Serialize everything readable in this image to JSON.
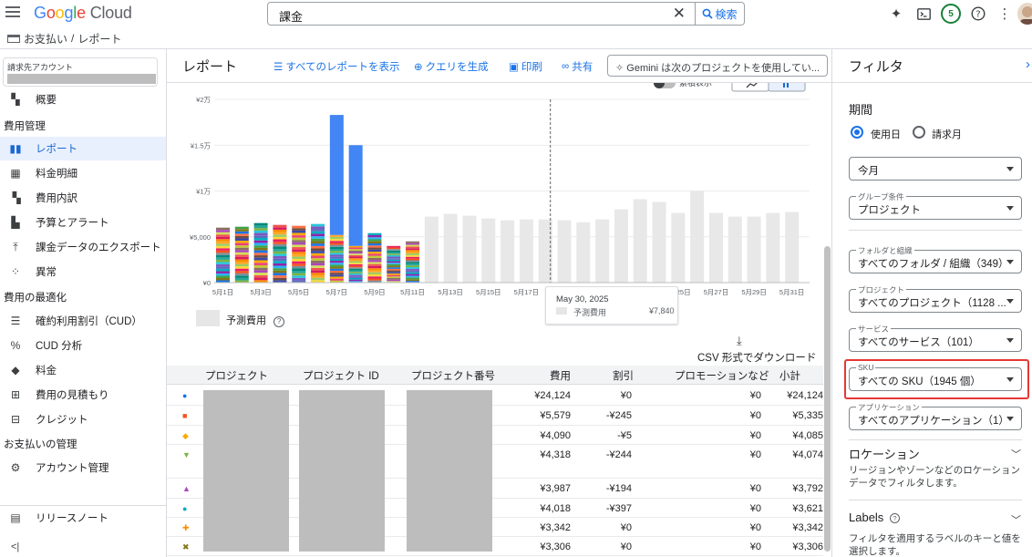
{
  "header": {
    "logo_parts": [
      "G",
      "o",
      "o",
      "g",
      "l",
      "e"
    ],
    "logo_suffix": "Cloud",
    "search_value": "課金",
    "search_button": "検索",
    "notification_count": "5"
  },
  "breadcrumb": {
    "items": [
      "お支払い",
      "/",
      "レポート"
    ]
  },
  "sidebar": {
    "account_label": "請求先アカウント",
    "top_item": {
      "label": "概要",
      "icon": "dashboard-icon"
    },
    "sections": [
      {
        "title": "費用管理"
      },
      {
        "title": "費用の最適化"
      },
      {
        "title": "お支払いの管理"
      }
    ],
    "cost_items": [
      {
        "label": "レポート",
        "icon": "bar-chart-icon",
        "active": true
      },
      {
        "label": "料金明細",
        "icon": "table-icon"
      },
      {
        "label": "費用内訳",
        "icon": "waterfall-icon"
      },
      {
        "label": "予算とアラート",
        "icon": "budget-icon"
      },
      {
        "label": "課金データのエクスポート",
        "icon": "export-icon"
      },
      {
        "label": "異常",
        "icon": "anomaly-icon"
      }
    ],
    "optimize_items": [
      {
        "label": "確約利用割引（CUD）",
        "icon": "list-icon"
      },
      {
        "label": "CUD 分析",
        "icon": "percent-icon"
      },
      {
        "label": "料金",
        "icon": "tag-icon"
      },
      {
        "label": "費用の見積もり",
        "icon": "calculator-icon"
      },
      {
        "label": "クレジット",
        "icon": "gift-icon"
      }
    ],
    "payment_items": [
      {
        "label": "アカウント管理",
        "icon": "gear-icon"
      }
    ],
    "release_notes": "リリースノート",
    "collapse": "<|"
  },
  "main": {
    "title": "レポート",
    "toolbar": {
      "all_reports": "すべてのレポートを表示",
      "generate_query": "クエリを生成",
      "print": "印刷",
      "share": "共有",
      "gemini": "Gemini は次のプロジェクトを使用してい..."
    },
    "cumulative_label": "累積表示",
    "chart_legend": "予測費用",
    "download": "CSV 形式でダウンロード",
    "tooltip": {
      "date": "May 30, 2025",
      "series": "予測費用",
      "value": "¥7,840"
    }
  },
  "chart_data": {
    "type": "bar",
    "stacked": true,
    "ylim": [
      0,
      20000
    ],
    "y_ticks": [
      "¥0",
      "¥5,000",
      "¥1万",
      "¥1.5万",
      "¥2万"
    ],
    "y_tick_values": [
      0,
      5000,
      10000,
      15000,
      20000
    ],
    "x_tick_labels": [
      "5月1日",
      "5月3日",
      "5月5日",
      "5月7日",
      "5月9日",
      "5月11日",
      "5月13日",
      "5月15日",
      "5月17日",
      "5月19日",
      "5月21日",
      "5月23日",
      "5月25日",
      "5月27日",
      "5月29日",
      "5月31日"
    ],
    "days": [
      1,
      2,
      3,
      4,
      5,
      6,
      7,
      8,
      9,
      10,
      11,
      12,
      13,
      14,
      15,
      16,
      17,
      18,
      19,
      20,
      21,
      22,
      23,
      24,
      25,
      26,
      27,
      28,
      29,
      30,
      31
    ],
    "actual_totals": [
      6000,
      6100,
      6500,
      6300,
      6200,
      6400,
      18300,
      15000,
      5400,
      4000,
      4500
    ],
    "forecast_totals": [
      7200,
      7500,
      7300,
      7000,
      6800,
      6900,
      6900,
      6800,
      6600,
      6900,
      8000,
      9100,
      8800,
      7600,
      10000,
      7600,
      7200,
      7200,
      7600,
      7700,
      7600,
      7800
    ],
    "highlight_bar_value": [
      13100,
      11000
    ],
    "forecast_start_day": 12,
    "today_marker_day": 18,
    "grid": true,
    "legend": "bottom-left"
  },
  "table": {
    "columns": [
      "プロジェクト",
      "プロジェクト ID",
      "プロジェクト番号",
      "費用",
      "割引",
      "プロモーションなど",
      "小計"
    ],
    "sort_indicator": "↓",
    "rows": [
      {
        "marker": "●",
        "marker_color": "#1a73e8",
        "cost": "¥24,124",
        "discount": "¥0",
        "promo": "¥0",
        "subtotal": "¥24,124"
      },
      {
        "marker": "■",
        "marker_color": "#f4511e",
        "cost": "¥5,579",
        "discount": "-¥245",
        "promo": "¥0",
        "subtotal": "¥5,335"
      },
      {
        "marker": "◆",
        "marker_color": "#f9ab00",
        "cost": "¥4,090",
        "discount": "-¥5",
        "promo": "¥0",
        "subtotal": "¥4,085"
      },
      {
        "marker": "▼",
        "marker_color": "#7cb342",
        "cost": "¥4,318",
        "discount": "-¥244",
        "promo": "¥0",
        "subtotal": "¥4,074"
      },
      {
        "marker": "▲",
        "marker_color": "#ab47bc",
        "cost": "¥3,987",
        "discount": "-¥194",
        "promo": "¥0",
        "subtotal": "¥3,792"
      },
      {
        "marker": "●",
        "marker_color": "#00acc1",
        "cost": "¥4,018",
        "discount": "-¥397",
        "promo": "¥0",
        "subtotal": "¥3,621"
      },
      {
        "marker": "✚",
        "marker_color": "#fb8c00",
        "cost": "¥3,342",
        "discount": "¥0",
        "promo": "¥0",
        "subtotal": "¥3,342"
      },
      {
        "marker": "✖",
        "marker_color": "#827717",
        "cost": "¥3,306",
        "discount": "¥0",
        "promo": "¥0",
        "subtotal": "¥3,306"
      }
    ]
  },
  "filters": {
    "title": "フィルタ",
    "period_label": "期間",
    "radio_usage": "使用日",
    "radio_invoice": "請求月",
    "period_value": "今月",
    "group_label": "グループ条件",
    "group_value": "プロジェクト",
    "folder_label": "フォルダと組織",
    "folder_value": "すべてのフォルダ / 組織（349）",
    "project_label": "プロジェクト",
    "project_value": "すべてのプロジェクト（1128 ...",
    "service_label": "サービス",
    "service_value": "すべてのサービス（101）",
    "sku_label": "SKU",
    "sku_value": "すべての SKU（1945 個）",
    "app_label": "アプリケーション",
    "app_value": "すべてのアプリケーション（1）",
    "location_title": "ロケーション",
    "location_desc": "リージョンやゾーンなどのロケーション データでフィルタします。",
    "labels_title": "Labels",
    "labels_desc": "フィルタを適用するラベルのキーと値を選択します。"
  }
}
